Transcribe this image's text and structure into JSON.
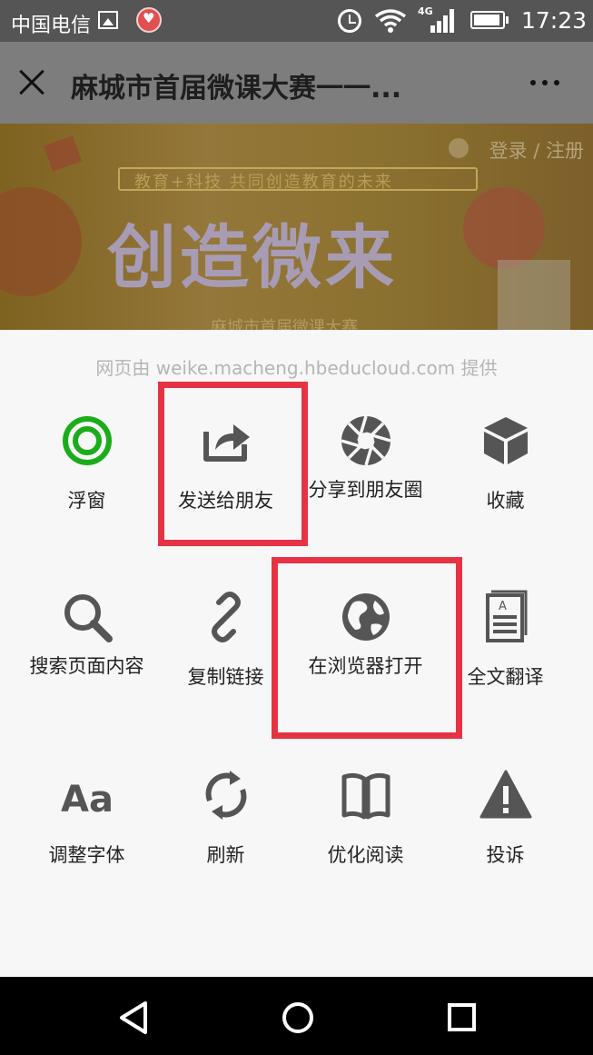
{
  "status_bar": {
    "carrier": "中国电信",
    "network": "4G",
    "time": "17:23",
    "icons": [
      "image-icon",
      "app-notification-icon",
      "alarm-icon",
      "wifi-icon",
      "signal-icon",
      "battery-icon"
    ]
  },
  "title_bar": {
    "title": "麻城市首届微课大赛一一...",
    "close_icon": "close-icon",
    "more_icon": "more-icon"
  },
  "banner": {
    "login_text": "登录 / 注册",
    "tagline": "教育+科技  共同创造教育的未来",
    "headline": "创造微来",
    "subtitle": "麻城市首届微课大赛"
  },
  "sheet": {
    "source": "网页由 weike.macheng.hbeducloud.com 提供",
    "rows": [
      [
        {
          "label": "浮窗",
          "icon": "floating-window-icon",
          "color": "#1aad19"
        },
        {
          "label": "发送给朋友",
          "icon": "send-to-friend-icon",
          "color": "#555555"
        },
        {
          "label": "分享到朋友圈",
          "icon": "moments-icon",
          "color": "#555555"
        },
        {
          "label": "收藏",
          "icon": "favorite-icon",
          "color": "#555555"
        }
      ],
      [
        {
          "label": "搜索页面内容",
          "icon": "search-icon",
          "color": "#555555"
        },
        {
          "label": "复制链接",
          "icon": "link-icon",
          "color": "#555555"
        },
        {
          "label": "在浏览器打开",
          "icon": "globe-icon",
          "color": "#555555"
        },
        {
          "label": "全文翻译",
          "icon": "translate-icon",
          "color": "#555555"
        }
      ],
      [
        {
          "label": "调整字体",
          "icon": "font-size-icon",
          "color": "#555555"
        },
        {
          "label": "刷新",
          "icon": "refresh-icon",
          "color": "#555555"
        },
        {
          "label": "优化阅读",
          "icon": "reader-mode-icon",
          "color": "#555555"
        },
        {
          "label": "投诉",
          "icon": "warning-icon",
          "color": "#555555"
        }
      ]
    ],
    "highlight_color": "#e63344"
  },
  "nav_bar": {
    "buttons": [
      "back-icon",
      "home-icon",
      "recent-apps-icon"
    ]
  }
}
